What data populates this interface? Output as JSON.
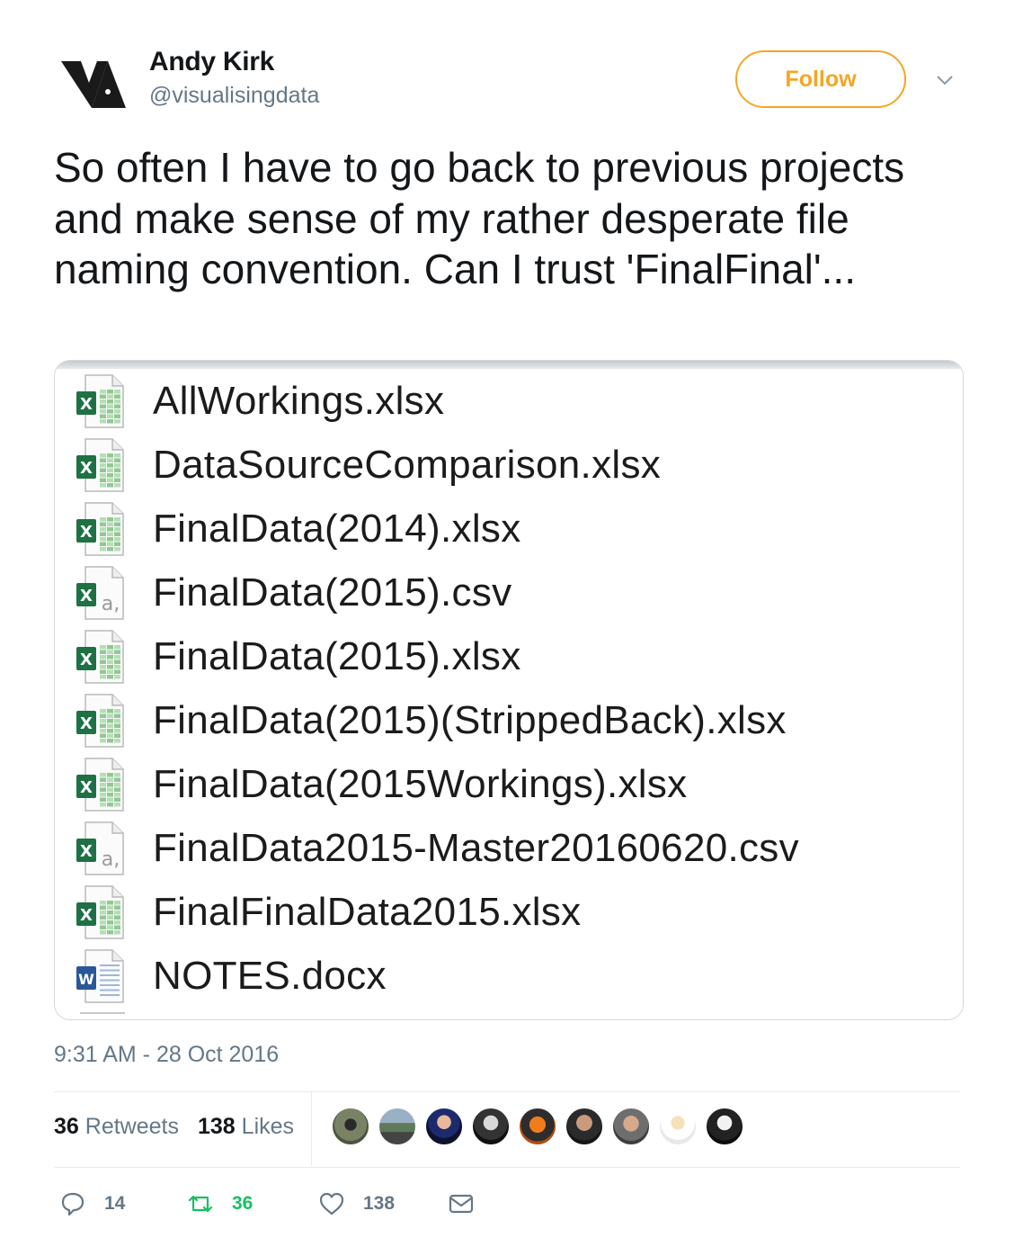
{
  "author": {
    "name": "Andy Kirk",
    "handle": "@visualisingdata",
    "follow_label": "Follow"
  },
  "tweet": {
    "text": "So often I have to go back to previous projects and make sense of my rather desperate file naming convention. Can I trust 'FinalFinal'...",
    "timestamp": "9:31 AM - 28 Oct 2016"
  },
  "media": {
    "files": [
      {
        "name": "AllWorkings.xlsx",
        "type": "xlsx"
      },
      {
        "name": "DataSourceComparison.xlsx",
        "type": "xlsx"
      },
      {
        "name": "FinalData(2014).xlsx",
        "type": "xlsx"
      },
      {
        "name": "FinalData(2015).csv",
        "type": "csv"
      },
      {
        "name": "FinalData(2015).xlsx",
        "type": "xlsx"
      },
      {
        "name": "FinalData(2015)(StrippedBack).xlsx",
        "type": "xlsx"
      },
      {
        "name": "FinalData(2015Workings).xlsx",
        "type": "xlsx"
      },
      {
        "name": "FinalData2015-Master20160620.csv",
        "type": "csv"
      },
      {
        "name": "FinalFinalData2015.xlsx",
        "type": "xlsx"
      },
      {
        "name": "NOTES.docx",
        "type": "docx"
      }
    ]
  },
  "stats": {
    "retweets_count": "36",
    "retweets_label": "Retweets",
    "likes_count": "138",
    "likes_label": "Likes"
  },
  "actions": {
    "reply_count": "14",
    "retweet_count": "36",
    "like_count": "138"
  },
  "colors": {
    "accent": "#f5a623",
    "retweet_green": "#17bf63",
    "secondary_text": "#657786"
  }
}
